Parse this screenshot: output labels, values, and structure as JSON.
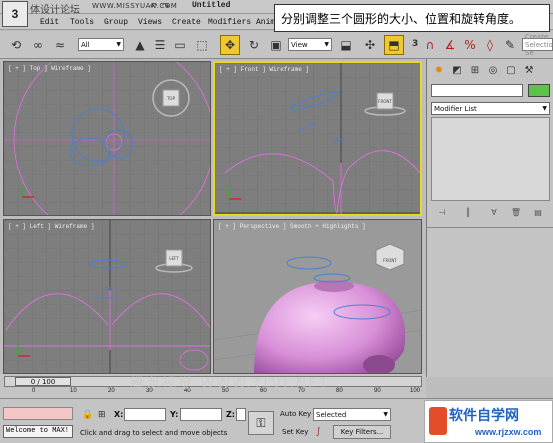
{
  "title_bar": {
    "watermark_text": "体设计论坛",
    "watermark_url": "WWW.MISSYUAN.COM",
    "window_title": "Untitled"
  },
  "menu": {
    "items": [
      "Edit",
      "Tools",
      "Group",
      "Views",
      "Create",
      "Modifiers",
      "Anim"
    ]
  },
  "callout": {
    "text": "分别调整三个圆形的大小、位置和旋转角度。"
  },
  "toolbar": {
    "selection_filter": "All",
    "reference_coord": "View",
    "snap_count": "3",
    "named_selection_placeholder": "Create Selection Se"
  },
  "viewports": {
    "top": {
      "label": "[ + ] Top ] Wireframe ]",
      "cube_label": "TOP"
    },
    "front": {
      "label": "[ + ] Front ] Wireframe ]",
      "cube_label": "FRONT"
    },
    "left": {
      "label": "[ + ] Left ] Wireframe ]",
      "cube_label": "LEFT"
    },
    "perspective": {
      "label": "[ + ] Perspective ] Smooth + Highlights ]",
      "cube_label": "FRONT"
    }
  },
  "command_panel": {
    "modifier_list": "Modifier List"
  },
  "timeline": {
    "frame_display": "0 / 100",
    "ticks": [
      "0",
      "10",
      "20",
      "30",
      "40",
      "50",
      "60",
      "70",
      "80",
      "90",
      "100"
    ]
  },
  "status": {
    "welcome": "Welcome to MAX!",
    "prompt": "Click and drag to select and move objects",
    "x_label": "X:",
    "y_label": "Y:",
    "z_label": "Z:",
    "auto_key": "Auto Key",
    "set_key": "Set Key",
    "selected": "Selected",
    "key_filters": "Key Filters..."
  },
  "watermarks": {
    "bottom_center": "腾龙视觉 WWW.TLVI.NET",
    "site_logo": "软件自学网",
    "site_url": "www.rjzxw.com"
  },
  "colors": {
    "active_viewport_border": "#e8d820",
    "object_pink": "#e070e0",
    "shape_blue": "#4a7fd0",
    "apple_pink": "#d890d8"
  }
}
